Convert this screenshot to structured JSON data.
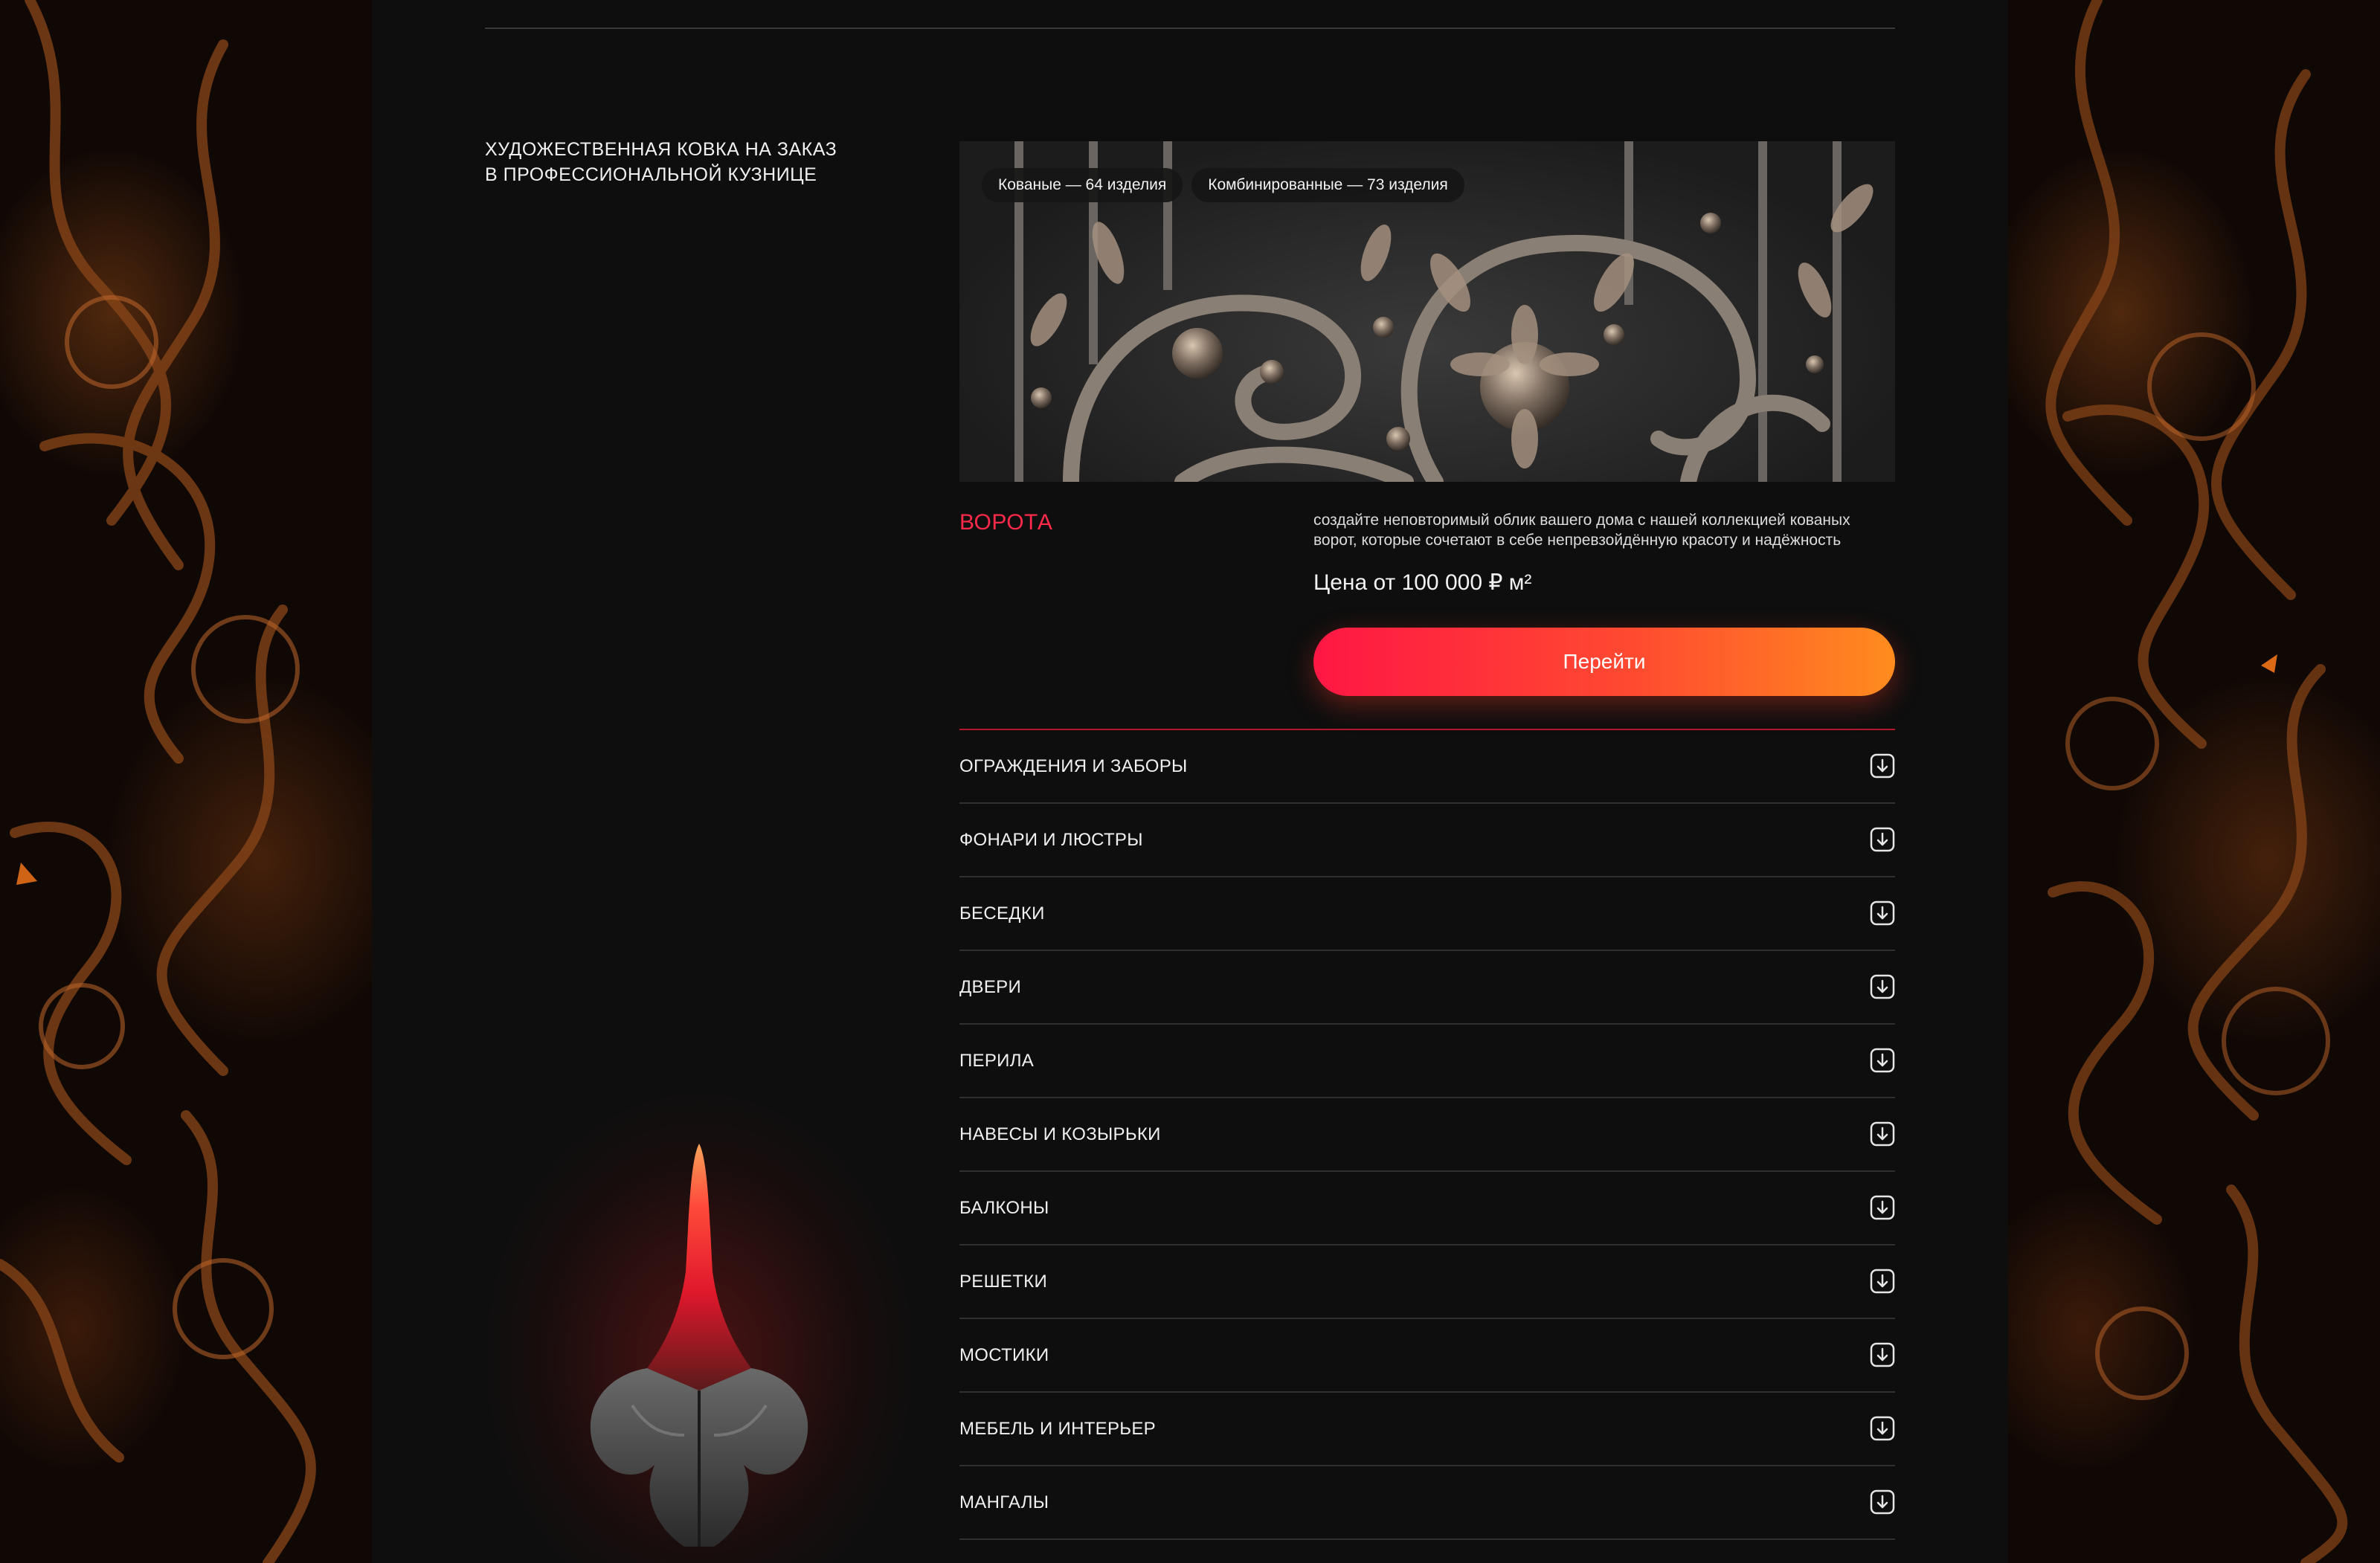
{
  "tagline": {
    "line1": "ХУДОЖЕСТВЕННАЯ КОВКА НА ЗАКАЗ",
    "line2": "В ПРОФЕССИОНАЛЬНОЙ КУЗНИЦЕ"
  },
  "featured": {
    "chips": [
      {
        "label": "Кованые — 64 изделия"
      },
      {
        "label": "Комбинированные — 73 изделия"
      }
    ],
    "title": "ВОРОТА",
    "description_line1": "создайте неповторимый облик вашего дома с нашей коллекцией кованых",
    "description_line2": "ворот, которые сочетают в себе непревзойдённую красоту и надёжность",
    "price": "Цена от 100 000 ₽ м²",
    "button_label": "Перейти"
  },
  "categories": [
    {
      "label": "ОГРАЖДЕНИЯ И ЗАБОРЫ",
      "icon": "arrow-down-square-icon"
    },
    {
      "label": "ФОНАРИ И ЛЮСТРЫ",
      "icon": "arrow-down-square-icon"
    },
    {
      "label": "БЕСЕДКИ",
      "icon": "arrow-down-square-icon"
    },
    {
      "label": "ДВЕРИ",
      "icon": "arrow-down-square-icon"
    },
    {
      "label": "ПЕРИЛА",
      "icon": "arrow-down-square-icon"
    },
    {
      "label": "НАВЕСЫ И КОЗЫРЬКИ",
      "icon": "arrow-down-square-icon"
    },
    {
      "label": "БАЛКОНЫ",
      "icon": "arrow-down-square-icon"
    },
    {
      "label": "РЕШЕТКИ",
      "icon": "arrow-down-square-icon"
    },
    {
      "label": "МОСТИКИ",
      "icon": "arrow-down-square-icon"
    },
    {
      "label": "МЕБЕЛЬ И ИНТЕРЬЕР",
      "icon": "arrow-down-square-icon"
    },
    {
      "label": "МАНГАЛЫ",
      "icon": "arrow-down-square-icon"
    }
  ],
  "colors": {
    "accent_red": "#ff2a4a",
    "button_gradient_start": "#ff1744",
    "button_gradient_end": "#ff8c1e",
    "background": "#0e0e0e"
  }
}
